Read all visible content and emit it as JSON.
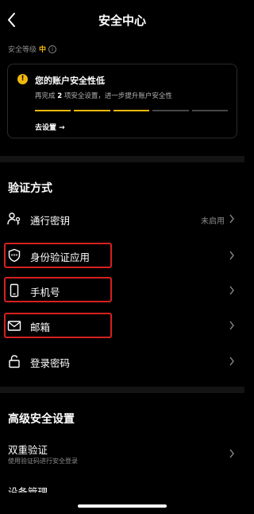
{
  "nav": {
    "title": "安全中心",
    "back_icon": "chevron-left-icon"
  },
  "security_level": {
    "label": "安全等级",
    "value": "中",
    "value_color": "#f0b90b",
    "info_icon": "info-icon"
  },
  "alert_card": {
    "icon": "warning-icon",
    "title": "您的账户安全性低",
    "subtitle_prefix": "再完成",
    "subtitle_count": "2",
    "subtitle_suffix": "项安全设置，进一步提升账户安全性",
    "progress_completed": 3,
    "progress_total": 5,
    "link_label": "去设置 →"
  },
  "verification": {
    "title": "验证方式",
    "items": [
      {
        "label": "通行密钥",
        "status": "未启用",
        "icon": "passkey-icon"
      },
      {
        "label": "身份验证应用",
        "status": "",
        "icon": "authenticator-icon",
        "highlighted": true
      },
      {
        "label": "手机号",
        "status": "",
        "icon": "phone-icon",
        "highlighted": true
      },
      {
        "label": "邮箱",
        "status": "",
        "icon": "mail-icon",
        "highlighted": true
      },
      {
        "label": "登录密码",
        "status": "",
        "icon": "lock-icon"
      }
    ]
  },
  "advanced": {
    "title": "高级安全设置",
    "items": [
      {
        "label": "双重验证",
        "subtitle": "使用验证码进行安全登录"
      }
    ],
    "cut_off_label": "设备管理"
  },
  "colors": {
    "accent": "#f0b90b",
    "highlight_box": "#d62020",
    "background": "#000000"
  }
}
